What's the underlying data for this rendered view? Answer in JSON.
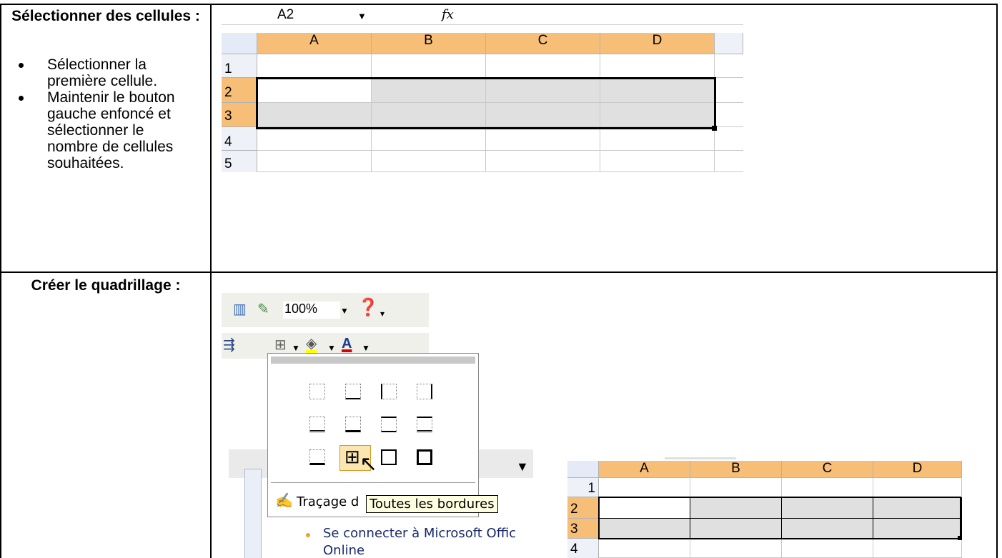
{
  "row1": {
    "title": "Sélectionner des cellules :",
    "bullets": [
      "Sélectionner la première cellule.",
      "Maintenir le bouton gauche enfoncé et sélectionner le nombre de cellules souhaitées."
    ]
  },
  "row2": {
    "title": "Créer le quadrillage :"
  },
  "sheet1": {
    "name_box": "A2",
    "fx": "fx",
    "columns": [
      "A",
      "B",
      "C",
      "D"
    ],
    "rows": [
      "1",
      "2",
      "3",
      "4",
      "5"
    ]
  },
  "toolbar": {
    "zoom": "100%",
    "draw_label": "Traçage d",
    "tooltip": "Toutes les bordures",
    "link_text": "Se connecter à Microsoft Offic",
    "link_text2": "Online"
  },
  "sheet2": {
    "columns": [
      "A",
      "B",
      "C",
      "D"
    ],
    "rows": [
      "1",
      "2",
      "3",
      "4"
    ]
  }
}
